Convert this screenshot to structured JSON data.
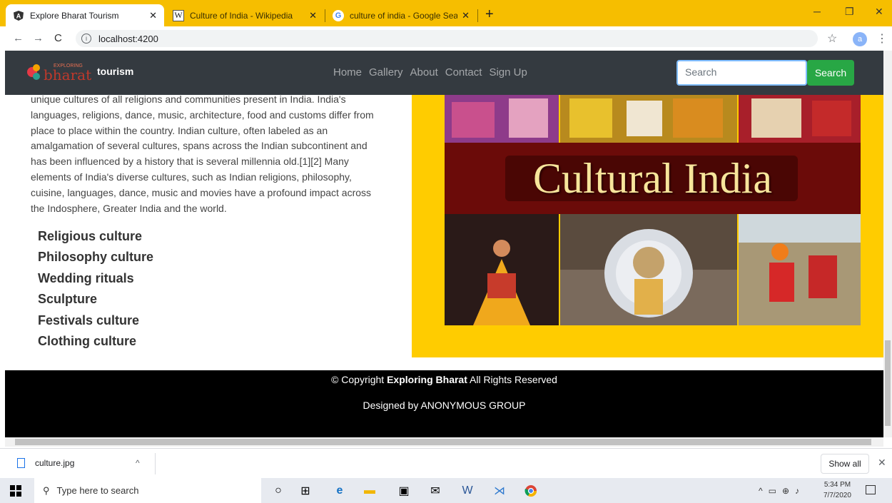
{
  "browser": {
    "tabs": [
      {
        "title": "Explore Bharat Tourism",
        "favicon": "angular-icon",
        "active": true
      },
      {
        "title": "Culture of India - Wikipedia",
        "favicon": "wikipedia-icon",
        "active": false
      },
      {
        "title": "culture of india - Google Search",
        "favicon": "google-icon",
        "active": false
      }
    ],
    "url": "localhost:4200",
    "profile_initial": "a"
  },
  "site": {
    "logo_text": "bharat",
    "logo_small_text": "EXPLORING",
    "brand": "tourism",
    "nav": [
      "Home",
      "Gallery",
      "About",
      "Contact",
      "Sign Up"
    ],
    "search_placeholder": "Search",
    "search_button": "Search"
  },
  "content": {
    "paragraph": "unique cultures of all religions and communities present in India. India's languages, religions, dance, music, architecture, food and customs differ from place to place within the country. Indian culture, often labeled as an amalgamation of several cultures, spans across the Indian subcontinent and has been influenced by a history that is several millennia old.[1][2] Many elements of India's diverse cultures, such as Indian religions, philosophy, cuisine, languages, dance, music and movies have a profound impact across the Indosphere, Greater India and the world.",
    "culture_list": [
      "Religious culture",
      "Philosophy culture",
      "Wedding rituals",
      "Sculpture",
      "Festivals culture",
      "Clothing culture"
    ],
    "banner_text": "Cultural India"
  },
  "footer": {
    "copyright_prefix": "© Copyright ",
    "copyright_brand": "Exploring Bharat",
    "copyright_suffix": " All Rights Reserved",
    "designed_by": "Designed by ANONYMOUS GROUP"
  },
  "downloads": {
    "file_name": "culture.jpg",
    "show_all": "Show all"
  },
  "taskbar": {
    "search_placeholder": "Type here to search",
    "time": "5:34 PM",
    "date": "7/7/2020"
  },
  "colors": {
    "tab_strip": "#f6be00",
    "navbar": "#343a40",
    "search_button": "#28a745",
    "image_panel": "#ffcc00",
    "banner": "#6b0b09"
  }
}
